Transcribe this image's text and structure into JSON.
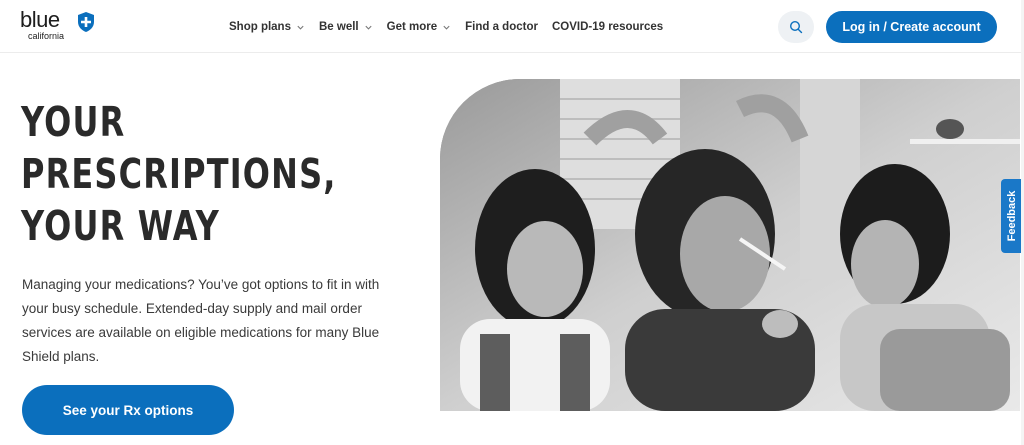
{
  "header": {
    "logo_word": "blue",
    "logo_sub": "california",
    "nav": [
      {
        "label": "Shop plans",
        "has_chevron": true
      },
      {
        "label": "Be well",
        "has_chevron": true
      },
      {
        "label": "Get more",
        "has_chevron": true
      },
      {
        "label": "Find a doctor",
        "has_chevron": false
      },
      {
        "label": "COVID-19 resources",
        "has_chevron": false
      }
    ],
    "search_icon": "search-icon",
    "login_label": "Log in / Create account"
  },
  "hero": {
    "headline_lines": [
      "YOUR",
      "PRESCRIPTIONS,",
      "YOUR WAY"
    ],
    "body": "Managing your medications? You’ve got options to fit in with your busy schedule. Extended-day supply and mail order services are available on eligible medications for many Blue Shield plans.",
    "cta_label": "See your Rx options"
  },
  "feedback_label": "Feedback",
  "colors": {
    "brand_blue": "#0b6fbd",
    "text_dark": "#2a2a2a",
    "search_bg": "#eef1f4"
  }
}
